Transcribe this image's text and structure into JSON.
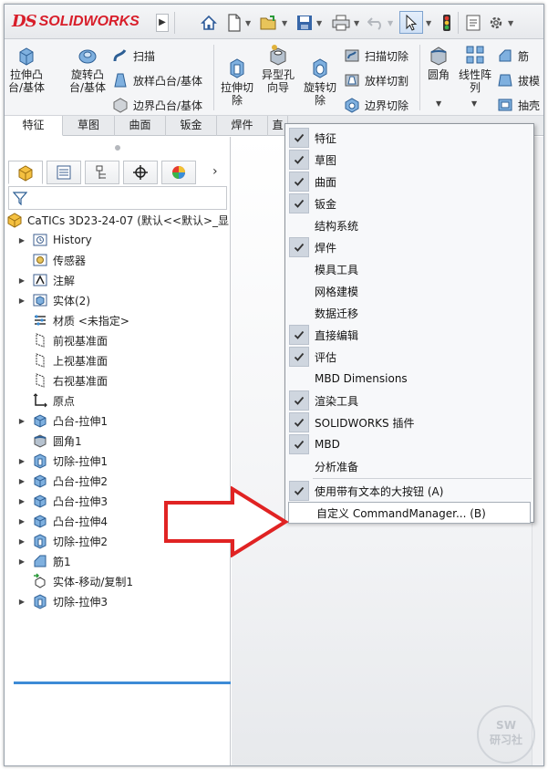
{
  "app": {
    "logo_ds": "DS",
    "logo_text": "SOLIDWORKS",
    "expand_glyph": "▶"
  },
  "quick_access": [
    {
      "name": "home-icon",
      "glyph": "⌂"
    },
    {
      "name": "new-document-icon",
      "glyph": "🗋"
    },
    {
      "name": "open-icon",
      "glyph": "📂"
    },
    {
      "name": "save-icon",
      "glyph": "💾"
    },
    {
      "name": "print-icon",
      "glyph": "🖶"
    },
    {
      "name": "undo-icon",
      "glyph": "↶"
    },
    {
      "name": "select-icon",
      "glyph": "⇖"
    },
    {
      "name": "rebuild-traffic-light-icon",
      "glyph": "●"
    },
    {
      "name": "options-gear-icon",
      "glyph": "⚙"
    }
  ],
  "ribbon": {
    "extrude_boss": "拉伸凸\n台/基体",
    "revolve_boss": "旋转凸\n台/基体",
    "sweep": "扫描",
    "loft_boss": "放样凸台/基体",
    "boundary_boss": "边界凸台/基体",
    "extrude_cut": "拉伸切\n除",
    "hole_wizard": "异型孔\n向导",
    "revolve_cut": "旋转切\n除",
    "swept_cut": "扫描切除",
    "lofted_cut": "放样切割",
    "boundary_cut": "边界切除",
    "fillet": "圆角",
    "linear_pattern": "线性阵\n列",
    "rib": "筋",
    "draft": "拔模",
    "shell": "抽壳"
  },
  "tabs": [
    "特征",
    "草图",
    "曲面",
    "钣金",
    "焊件",
    "直"
  ],
  "active_tab": "特征",
  "feature_manager": {
    "tab_icons": [
      "feature-manager-icon",
      "property-manager-icon",
      "configuration-manager-icon",
      "dimxpert-icon",
      "display-manager-icon"
    ],
    "root": "CaTICs 3D23-24-07  (默认<<默认>_显",
    "items": [
      {
        "label": "History",
        "expandable": true,
        "icon": "history-icon"
      },
      {
        "label": "传感器",
        "expandable": false,
        "icon": "sensor-icon"
      },
      {
        "label": "注解",
        "expandable": true,
        "icon": "annotation-icon"
      },
      {
        "label": "实体(2)",
        "expandable": true,
        "icon": "solid-bodies-icon"
      },
      {
        "label": "材质 <未指定>",
        "expandable": false,
        "icon": "material-icon"
      },
      {
        "label": "前视基准面",
        "expandable": false,
        "icon": "plane-icon"
      },
      {
        "label": "上视基准面",
        "expandable": false,
        "icon": "plane-icon"
      },
      {
        "label": "右视基准面",
        "expandable": false,
        "icon": "plane-icon"
      },
      {
        "label": "原点",
        "expandable": false,
        "icon": "origin-icon"
      },
      {
        "label": "凸台-拉伸1",
        "expandable": true,
        "icon": "boss-extrude-icon"
      },
      {
        "label": "圆角1",
        "expandable": false,
        "icon": "fillet-icon"
      },
      {
        "label": "切除-拉伸1",
        "expandable": true,
        "icon": "cut-extrude-icon"
      },
      {
        "label": "凸台-拉伸2",
        "expandable": true,
        "icon": "boss-extrude-icon"
      },
      {
        "label": "凸台-拉伸3",
        "expandable": true,
        "icon": "boss-extrude-icon"
      },
      {
        "label": "凸台-拉伸4",
        "expandable": true,
        "icon": "boss-extrude-icon"
      },
      {
        "label": "切除-拉伸2",
        "expandable": true,
        "icon": "cut-extrude-icon"
      },
      {
        "label": "筋1",
        "expandable": true,
        "icon": "rib-icon"
      },
      {
        "label": "实体-移动/复制1",
        "expandable": false,
        "icon": "move-copy-icon"
      },
      {
        "label": "切除-拉伸3",
        "expandable": true,
        "icon": "cut-extrude-icon"
      }
    ]
  },
  "context_menu": {
    "items": [
      {
        "label": "特征",
        "checked": true
      },
      {
        "label": "草图",
        "checked": true
      },
      {
        "label": "曲面",
        "checked": true
      },
      {
        "label": "钣金",
        "checked": true
      },
      {
        "label": "结构系统",
        "checked": false
      },
      {
        "label": "焊件",
        "checked": true
      },
      {
        "label": "模具工具",
        "checked": false
      },
      {
        "label": "网格建模",
        "checked": false
      },
      {
        "label": "数据迁移",
        "checked": false
      },
      {
        "label": "直接编辑",
        "checked": true
      },
      {
        "label": "评估",
        "checked": true
      },
      {
        "label": "MBD Dimensions",
        "checked": false
      },
      {
        "label": "渲染工具",
        "checked": true
      },
      {
        "label": "SOLIDWORKS 插件",
        "checked": true
      },
      {
        "label": "MBD",
        "checked": true
      },
      {
        "label": "分析准备",
        "checked": false
      }
    ],
    "large_buttons": {
      "label": "使用带有文本的大按钮 (A)",
      "checked": true
    },
    "customize": {
      "label": "自定义 CommandManager... (B)",
      "checked": false
    }
  },
  "colors": {
    "brand_red": "#d81e2a",
    "arrow_red": "#e02323",
    "selection_blue": "#3d8bd6"
  },
  "watermark": "SW\n研习社"
}
